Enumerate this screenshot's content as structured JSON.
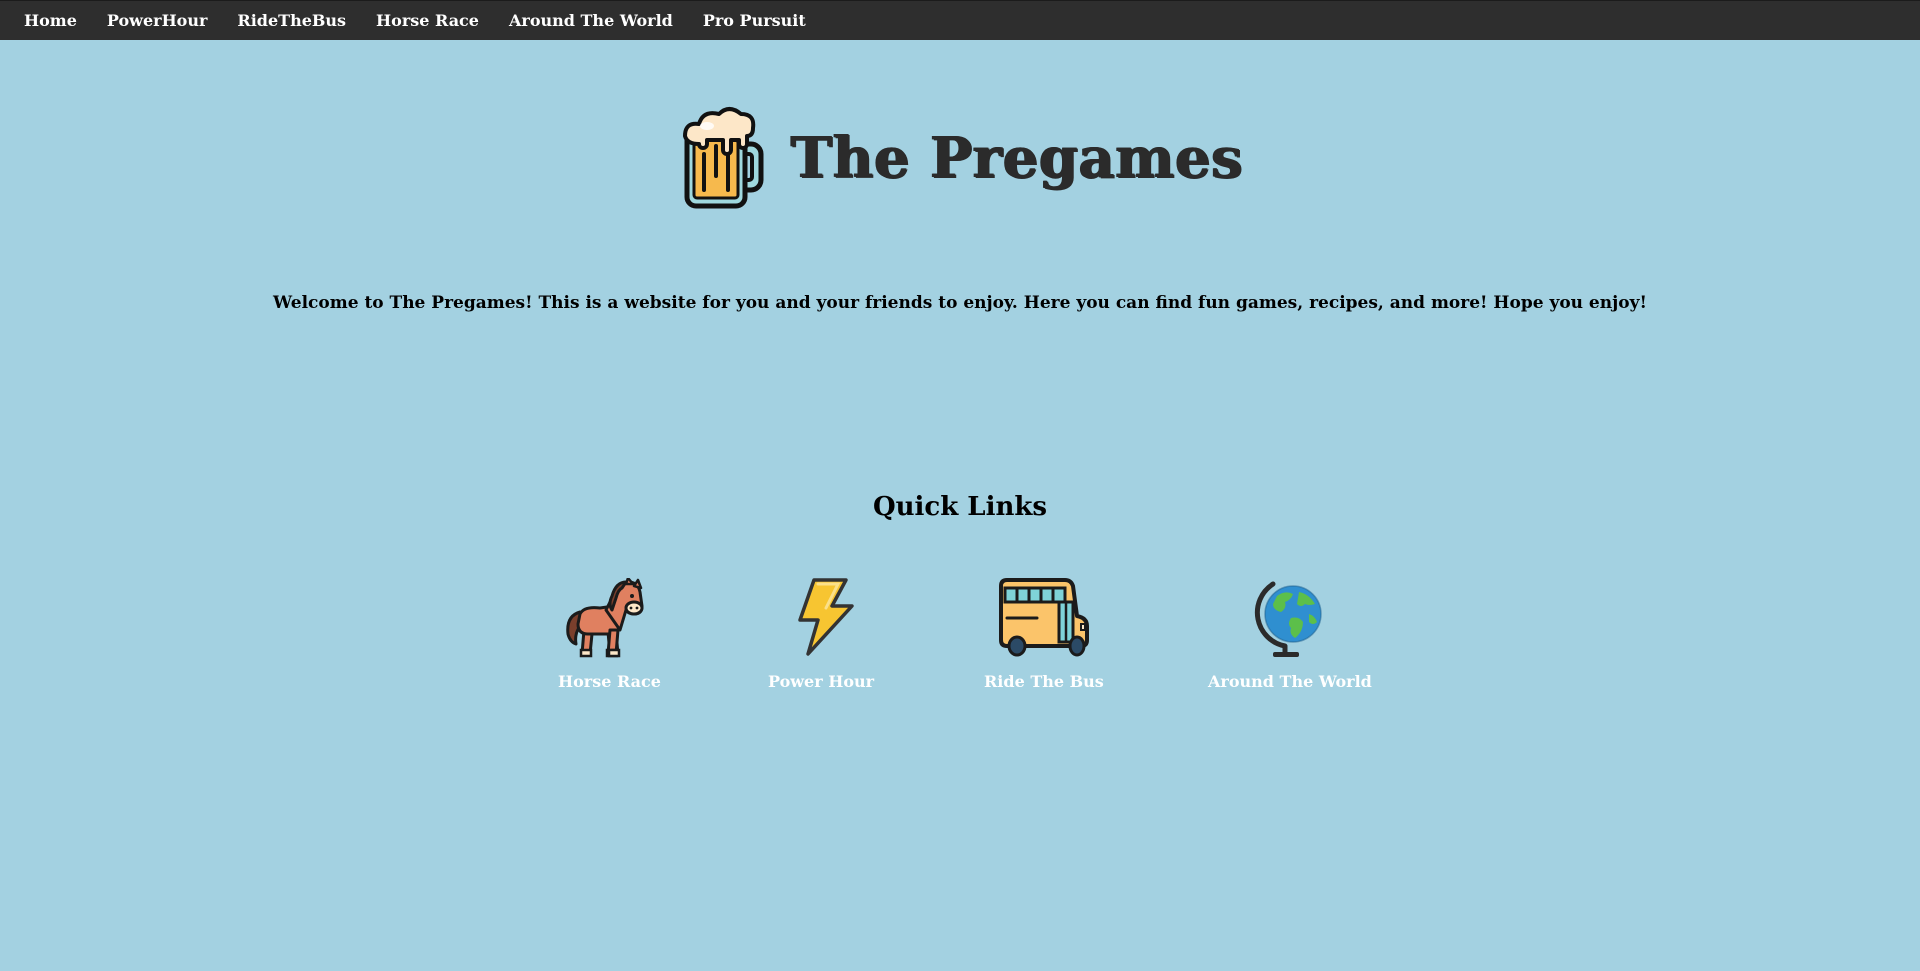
{
  "nav": {
    "items": [
      {
        "label": "Home"
      },
      {
        "label": "PowerHour"
      },
      {
        "label": "RideTheBus"
      },
      {
        "label": "Horse Race"
      },
      {
        "label": "Around The World"
      },
      {
        "label": "Pro Pursuit"
      }
    ]
  },
  "hero": {
    "logo_icon": "beer-mug-icon",
    "title": "The Pregames"
  },
  "welcome": {
    "text": "Welcome to The Pregames! This is a website for you and your friends to enjoy. Here you can find fun games, recipes, and more! Hope you enjoy!"
  },
  "quick_links": {
    "title": "Quick Links",
    "items": [
      {
        "label": "Horse Race",
        "icon": "horse-icon"
      },
      {
        "label": "Power Hour",
        "icon": "lightning-bolt-icon"
      },
      {
        "label": "Ride The Bus",
        "icon": "bus-icon"
      },
      {
        "label": "Around The World",
        "icon": "globe-icon"
      }
    ]
  },
  "colors": {
    "background": "#a3d1e1",
    "navbar": "#2e2e2e",
    "title_text": "#2b2b2b",
    "quick_label_text": "#ffffff"
  }
}
